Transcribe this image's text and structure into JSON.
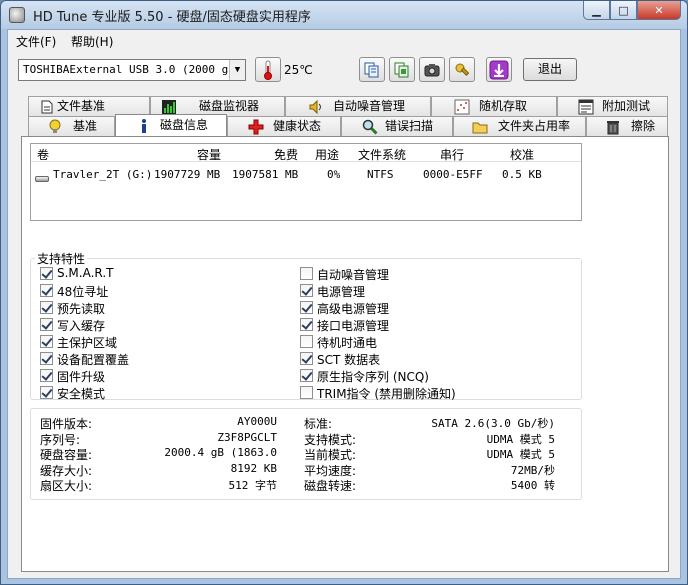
{
  "window": {
    "title": "HD Tune 专业版 5.50 - 硬盘/固态硬盘实用程序",
    "min_glyph": "▁",
    "max_glyph": "□",
    "close_glyph": "✕"
  },
  "menu": [
    {
      "label": "文件(F)"
    },
    {
      "label": "帮助(H)"
    }
  ],
  "toolbar": {
    "drive": "TOSHIBAExternal USB 3.0 (2000 gB)",
    "temperature": "25℃",
    "exit_label": "退出",
    "buttons": [
      "copy-info-icon",
      "copy-screen-icon",
      "camera-icon",
      "options-icon",
      "download-icon"
    ]
  },
  "tabs_row1": [
    {
      "label": "文件基准",
      "icon": "file-benchmark-icon"
    },
    {
      "label": "磁盘监视器",
      "icon": "disk-monitor-icon"
    },
    {
      "label": "自动噪音管理",
      "icon": "speaker-icon"
    },
    {
      "label": "随机存取",
      "icon": "random-access-icon"
    },
    {
      "label": "附加测试",
      "icon": "extra-tests-icon"
    }
  ],
  "tabs_row2": [
    {
      "label": "基准",
      "icon": "benchmark-bulb-icon"
    },
    {
      "label": "磁盘信息",
      "icon": "info-icon",
      "active": true
    },
    {
      "label": "健康状态",
      "icon": "health-cross-icon"
    },
    {
      "label": "错误扫描",
      "icon": "magnifier-icon"
    },
    {
      "label": "文件夹占用率",
      "icon": "folder-icon"
    },
    {
      "label": "擦除",
      "icon": "trash-icon"
    }
  ],
  "disk_table": {
    "headers": [
      "卷",
      "容量",
      "免费",
      "用途",
      "文件系统",
      "串行",
      "校准"
    ],
    "rows": [
      [
        "Travler_2T (G:)",
        "1907729 MB",
        "1907581 MB",
        "0%",
        "NTFS",
        "0000-E5FF",
        "0.5 KB"
      ]
    ]
  },
  "features": {
    "title": "支持特性",
    "left": [
      {
        "label": "S.M.A.R.T",
        "checked": true
      },
      {
        "label": "48位寻址",
        "checked": true
      },
      {
        "label": "预先读取",
        "checked": true
      },
      {
        "label": "写入缓存",
        "checked": true
      },
      {
        "label": "主保护区域",
        "checked": true
      },
      {
        "label": "设备配置覆盖",
        "checked": true
      },
      {
        "label": "固件升级",
        "checked": true
      },
      {
        "label": "安全模式",
        "checked": true
      }
    ],
    "right": [
      {
        "label": "自动噪音管理",
        "checked": false
      },
      {
        "label": "电源管理",
        "checked": true
      },
      {
        "label": "高级电源管理",
        "checked": true
      },
      {
        "label": "接口电源管理",
        "checked": true
      },
      {
        "label": "待机时通电",
        "checked": false
      },
      {
        "label": "SCT 数据表",
        "checked": true
      },
      {
        "label": "原生指令序列 (NCQ)",
        "checked": true
      },
      {
        "label": "TRIM指令 (禁用删除通知)",
        "checked": false
      }
    ]
  },
  "info": {
    "left": [
      {
        "label": "固件版本:",
        "value": "AY000U"
      },
      {
        "label": "序列号:",
        "value": "Z3F8PGCLT"
      },
      {
        "label": "硬盘容量:",
        "value": "2000.4 gB (1863.0"
      },
      {
        "label": "缓存大小:",
        "value": "8192 KB"
      },
      {
        "label": "扇区大小:",
        "value": "512 字节"
      }
    ],
    "right": [
      {
        "label": "标准:",
        "value": "SATA 2.6(3.0 Gb/秒)"
      },
      {
        "label": "支持模式:",
        "value": "UDMA 模式 5"
      },
      {
        "label": "当前模式:",
        "value": "UDMA 模式 5"
      },
      {
        "label": "平均速度:",
        "value": "72MB/秒"
      },
      {
        "label": "磁盘转速:",
        "value": "5400 转"
      }
    ]
  }
}
